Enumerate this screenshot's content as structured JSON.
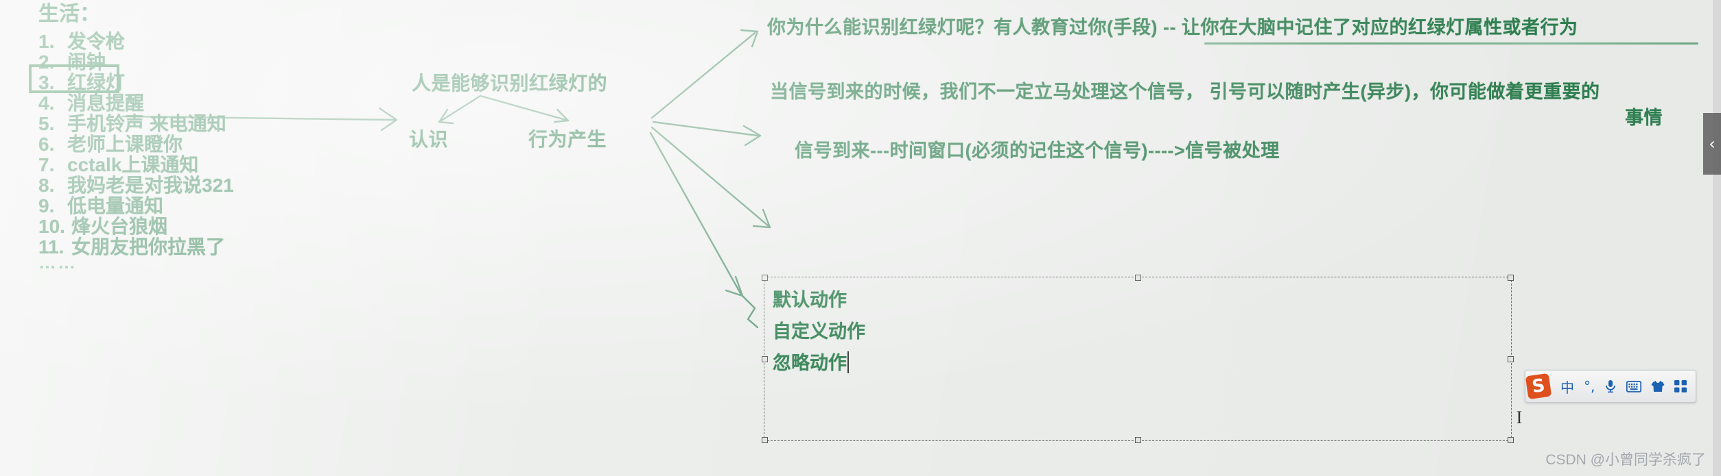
{
  "slide": {
    "background_color": "#eceeec",
    "ink_color": "#2f8050",
    "highlight_border_color": "#1f7a3c"
  },
  "left_list": {
    "heading": "生活：",
    "items": [
      {
        "num": "1.",
        "text": "发令枪"
      },
      {
        "num": "2.",
        "text": "闹钟"
      },
      {
        "num": "3.",
        "text": "红绿灯"
      },
      {
        "num": "4.",
        "text": "消息提醒"
      },
      {
        "num": "5.",
        "text": "手机铃声 来电通知"
      },
      {
        "num": "6.",
        "text": "老师上课瞪你"
      },
      {
        "num": "7.",
        "text": "cctalk上课通知"
      },
      {
        "num": "8.",
        "text": "我妈老是对我说321"
      },
      {
        "num": "9.",
        "text": "低电量通知"
      },
      {
        "num": "10.",
        "text": "烽火台狼烟"
      },
      {
        "num": "11.",
        "text": "女朋友把你拉黑了"
      }
    ],
    "ellipsis": "……",
    "highlighted_index": 2
  },
  "mindmap": {
    "center_node": "人是能够识别红绿灯的",
    "sub_nodes": [
      {
        "label": "认识"
      },
      {
        "label": "行为产生"
      }
    ],
    "branches": [
      {
        "id": "branch-1",
        "text": "你为什么能识别红绿灯呢？有人教育过你(手段) -- 让你在大脑中记住了对应的红绿灯属性或者行为"
      },
      {
        "id": "branch-2",
        "text": "当信号到来的时候，我们不一定立马处理这个信号， 引号可以随时产生(异步)，你可能做着更重要的",
        "wrap": "事情"
      },
      {
        "id": "branch-3",
        "text": "信号到来---时间窗口(必须的记住这个信号)---->信号被处理"
      }
    ]
  },
  "text_box": {
    "lines": [
      "默认动作",
      "自定义动作",
      "忽略动作"
    ],
    "caret_after_line": 2,
    "selected": true
  },
  "collapse_tab": {
    "icon": "chevron-left-icon",
    "glyph": "‹"
  },
  "ime_bar": {
    "logo_letter": "S",
    "items": [
      {
        "name": "input-mode-chinese",
        "glyph": "中"
      },
      {
        "name": "punctuation-mode",
        "glyph": "°,"
      },
      {
        "name": "voice-input",
        "glyph": "microphone-icon"
      },
      {
        "name": "soft-keyboard",
        "glyph": "keyboard-icon"
      },
      {
        "name": "skin-center",
        "glyph": "tshirt-icon"
      },
      {
        "name": "app-grid",
        "glyph": "grid-icon"
      }
    ]
  },
  "watermark": "CSDN @小曾同学杀疯了"
}
